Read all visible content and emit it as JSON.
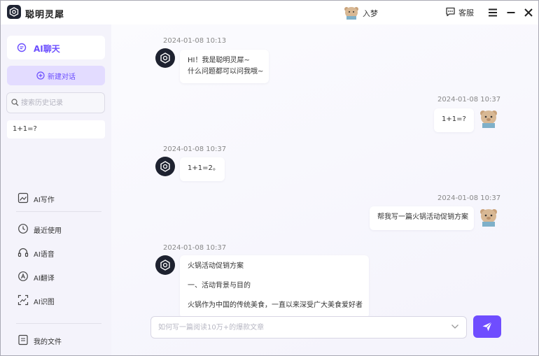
{
  "app": {
    "title": "聪明灵犀"
  },
  "titlebar": {
    "user_name": "入梦",
    "service_label": "客服"
  },
  "sidebar": {
    "chat_label": "AI聊天",
    "new_chat_label": "新建对话",
    "search_placeholder": "搜索历史记录",
    "history": [
      "1+1=?"
    ],
    "tools": {
      "writing": "AI写作",
      "recent": "最近使用",
      "voice": "AI语音",
      "translate": "AI翻译",
      "image": "AI识图",
      "files": "我的文件"
    }
  },
  "messages": [
    {
      "role": "bot",
      "time": "2024-01-08 10:13",
      "lines": [
        "HI！我是聪明灵犀~",
        "什么问题都可以问我哦~"
      ]
    },
    {
      "role": "user",
      "time": "2024-01-08 10:37",
      "lines": [
        "1+1=?"
      ]
    },
    {
      "role": "bot",
      "time": "2024-01-08 10:37",
      "lines": [
        "1+1=2。"
      ]
    },
    {
      "role": "user",
      "time": "2024-01-08 10:37",
      "lines": [
        "帮我写一篇火锅活动促销方案"
      ]
    },
    {
      "role": "bot",
      "time": "2024-01-08 10:37",
      "lines": [
        "火锅活动促销方案",
        "一、活动背景与目的",
        "火锅作为中国的传统美食，一直以来深受广大美食爱好者"
      ]
    }
  ],
  "composer": {
    "placeholder": "如何写一篇阅读10万+的爆款文章"
  },
  "colors": {
    "accent": "#6f4dff",
    "sidebar_bg": "#f4f3fb",
    "bot_avatar": "#1e2230"
  },
  "icons": {
    "logo": "app-logo-icon",
    "service": "chat-bubble-icon",
    "menu": "menu-icon",
    "minimize": "minimize-icon",
    "close": "close-icon",
    "send": "paper-plane-icon"
  }
}
